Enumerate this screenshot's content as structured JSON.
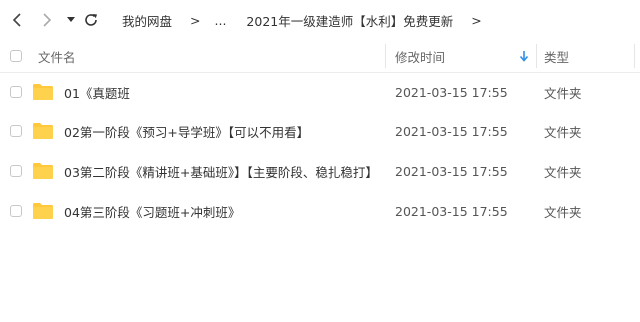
{
  "breadcrumb": {
    "root": "我的网盘",
    "sep1": ">",
    "ellipsis": "...",
    "current": "2021年一级建造师【水利】免费更新",
    "sep2": ">"
  },
  "columns": {
    "name": "文件名",
    "modified": "修改时间",
    "type": "类型",
    "sort": "modified-desc"
  },
  "rows": [
    {
      "name": "01《真题班",
      "modified": "2021-03-15 17:55",
      "type": "文件夹"
    },
    {
      "name": "02第一阶段《预习+导学班》【可以不用看】",
      "modified": "2021-03-15 17:55",
      "type": "文件夹"
    },
    {
      "name": "03第二阶段《精讲班+基础班》】【主要阶段、稳扎稳打】",
      "modified": "2021-03-15 17:55",
      "type": "文件夹"
    },
    {
      "name": "04第三阶段《习题班+冲刺班》",
      "modified": "2021-03-15 17:55",
      "type": "文件夹"
    }
  ],
  "colors": {
    "folder": "#ffc83d",
    "sort_arrow": "#2f8ee8",
    "divider": "#ececec"
  },
  "icons": [
    "back-icon",
    "forward-icon",
    "dropdown-icon",
    "refresh-icon",
    "folder-icon",
    "sort-arrow-icon"
  ]
}
